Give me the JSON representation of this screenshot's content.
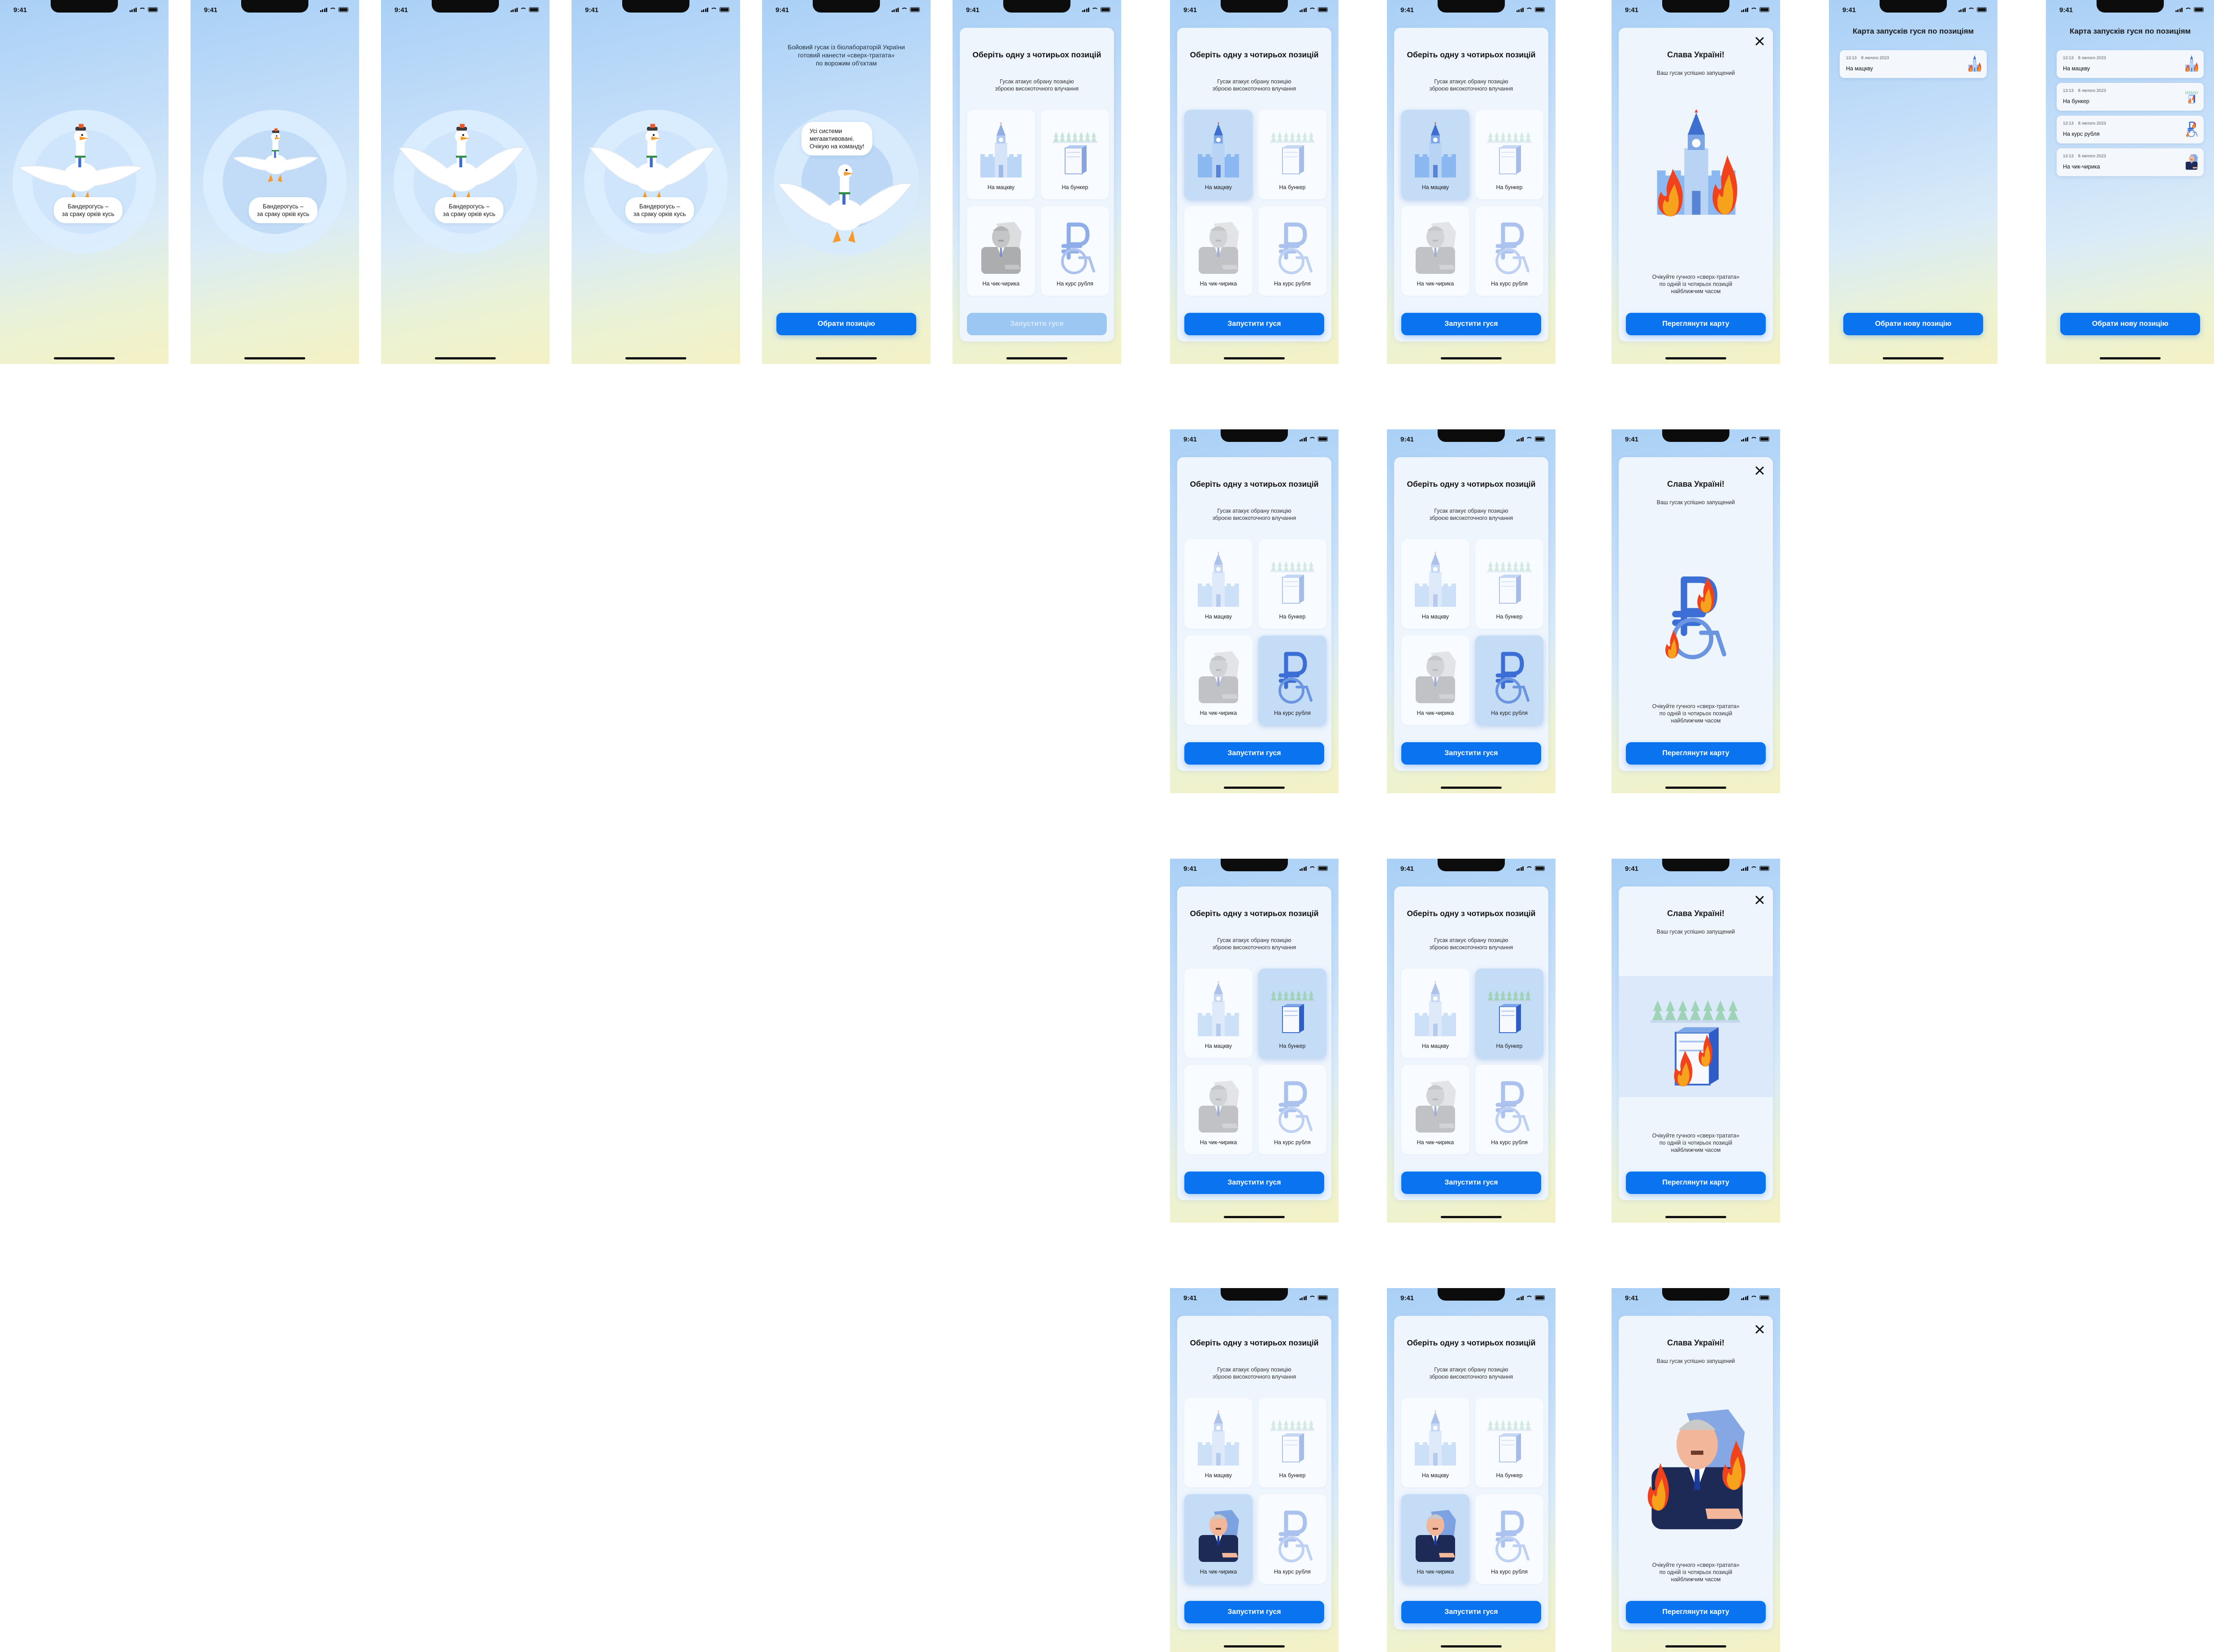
{
  "status": {
    "time": "9:41"
  },
  "intro": {
    "bubble": "Бандерогусь –\nза сраку орків кусь",
    "description": "Бойовий гусак із біолабораторій України\nготовий нанести «сверх-тратата»\nпо ворожим об'єктам",
    "ready_bubble": "Усі системи\nмегаактивовані.\nОчікую на команду!",
    "choose_button": "Обрати позицію"
  },
  "select": {
    "title": "Оберіть одну з чотирьох позицій",
    "subtitle": "Гусак атакує обрану позицію\nзброєю високоточного влучання",
    "targets": [
      "На мацкву",
      "На бункер",
      "На чик-чирика",
      "На курс рубля"
    ],
    "launch_button": "Запустити гуся"
  },
  "success": {
    "title": "Слава Україні!",
    "subtitle": "Ваш гусак успішно запущений",
    "body": "Очікуйте гучного «сверх-тратата»\nпо одній із чотирьох позицій\nнайближчим часом",
    "map_button": "Переглянути карту"
  },
  "map": {
    "title": "Карта запусків гуся по позиціям",
    "new_button": "Обрати нову позицію",
    "log_single": [
      {
        "time": "13:13",
        "date": "8 лютого 2023",
        "target": "На мацкву",
        "icon": "kremlin-icon"
      }
    ],
    "log_full": [
      {
        "time": "13:13",
        "date": "8 лютого 2023",
        "target": "На мацкву",
        "icon": "kremlin-icon"
      },
      {
        "time": "13:13",
        "date": "8 лютого 2023",
        "target": "На бункер",
        "icon": "bunker-icon"
      },
      {
        "time": "13:13",
        "date": "8 лютого 2023",
        "target": "На курс рубля",
        "icon": "ruble-icon"
      },
      {
        "time": "13:13",
        "date": "8 лютого 2023",
        "target": "На чик-чирика",
        "icon": "dictator-icon"
      }
    ]
  },
  "colors": {
    "accent": "#0a73f0",
    "fire": "#f6a21c",
    "flame_red": "#f0421c"
  }
}
